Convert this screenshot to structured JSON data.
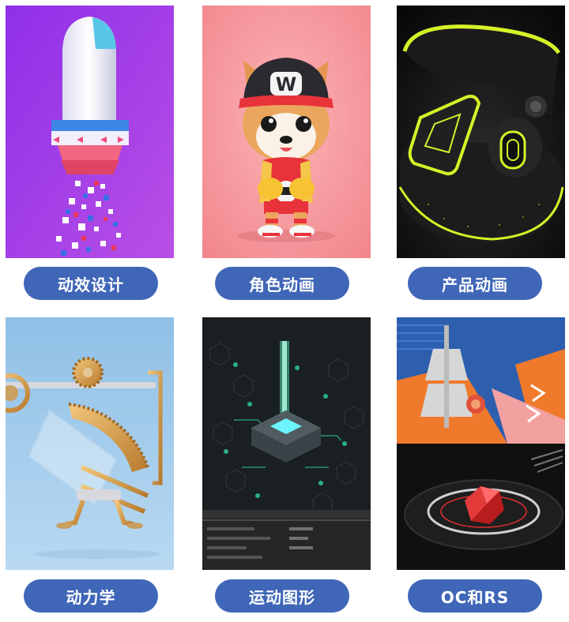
{
  "categories": [
    {
      "label": "动效设计"
    },
    {
      "label": "角色动画"
    },
    {
      "label": "产品动画"
    },
    {
      "label": "动力学"
    },
    {
      "label": "运动图形"
    },
    {
      "label": "OC和RS"
    }
  ],
  "thumb_text": {
    "cap_letter": "W"
  },
  "colors": {
    "pill": "#3f66b7",
    "pill_text": "#ffffff"
  }
}
